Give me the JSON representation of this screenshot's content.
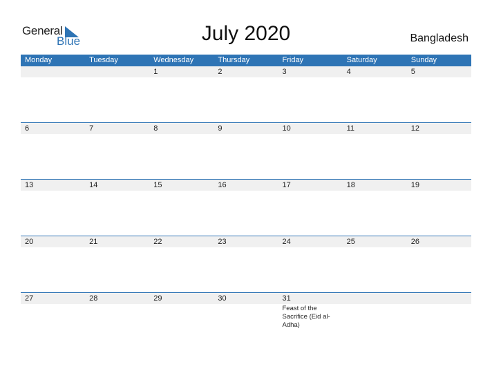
{
  "logo": {
    "general": "General",
    "blue": "Blue",
    "accent": "#2e74b5"
  },
  "title": "July 2020",
  "country": "Bangladesh",
  "weekdays": [
    "Monday",
    "Tuesday",
    "Wednesday",
    "Thursday",
    "Friday",
    "Saturday",
    "Sunday"
  ],
  "weeks": [
    {
      "days": [
        "",
        "",
        "1",
        "2",
        "3",
        "4",
        "5"
      ],
      "events": [
        "",
        "",
        "",
        "",
        "",
        "",
        ""
      ]
    },
    {
      "days": [
        "6",
        "7",
        "8",
        "9",
        "10",
        "11",
        "12"
      ],
      "events": [
        "",
        "",
        "",
        "",
        "",
        "",
        ""
      ]
    },
    {
      "days": [
        "13",
        "14",
        "15",
        "16",
        "17",
        "18",
        "19"
      ],
      "events": [
        "",
        "",
        "",
        "",
        "",
        "",
        ""
      ]
    },
    {
      "days": [
        "20",
        "21",
        "22",
        "23",
        "24",
        "25",
        "26"
      ],
      "events": [
        "",
        "",
        "",
        "",
        "",
        "",
        ""
      ]
    },
    {
      "days": [
        "27",
        "28",
        "29",
        "30",
        "31",
        "",
        ""
      ],
      "events": [
        "",
        "",
        "",
        "",
        "Feast of the Sacrifice (Eid al-Adha)",
        "",
        ""
      ]
    }
  ]
}
